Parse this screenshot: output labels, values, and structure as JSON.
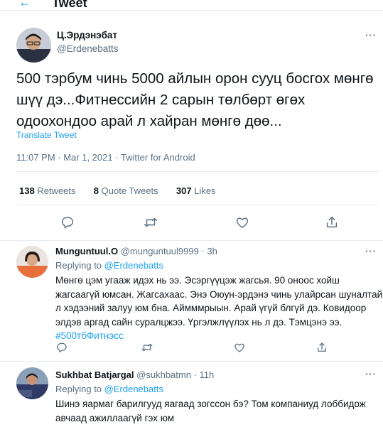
{
  "header": {
    "title": "Tweet"
  },
  "main_tweet": {
    "author_name": "Ц.Эрдэнэбат",
    "author_handle": "@Erdenebatts",
    "text": "500 тэрбум чинь 5000 айлын орон сууц босгох мөнгө шүү дэ...Фитнессийн 2 сарын төлбөрт өгөх одоохондоо арай л хайран мөнгө дөө...",
    "translate_label": "Translate Tweet",
    "timestamp": "11:07 PM · Mar 1, 2021 · Twitter for Android",
    "stats": {
      "retweets_count": "138",
      "retweets_label": "Retweets",
      "quotes_count": "8",
      "quotes_label": "Quote Tweets",
      "likes_count": "307",
      "likes_label": "Likes"
    }
  },
  "replies": [
    {
      "author_name": "Munguntuul.O",
      "author_handle": "@munguntuul9999",
      "time": "· 3h",
      "replying_prefix": "Replying to",
      "replying_to": "@Erdenebatts",
      "text_lines": [
        "Мөнгө цэм угааж идэх нь ээ. Эсэргүүцэж жагсья. 90 оноос хойш",
        "жагсаагүй юмсан. Жагсахаас. Энэ Оюун-эрдэнэ чинь улайрсан шуналтай",
        "л хэдээний залуу юм бна. Аймммрыын. Арай үгүй блгүй дэ. Ковидоор",
        "элдэв аргад сайн суралцжээ. Үргэлжлүүлэх нь л дэ. Тэмцэнэ ээ."
      ],
      "hashtag": "#500тбФитнэсс"
    },
    {
      "author_name": "Sukhbat Batjargal",
      "author_handle": "@sukhbatmn",
      "time": "· 11h",
      "replying_prefix": "Replying to",
      "replying_to": "@Erdenebatts",
      "text_lines": [
        "Шинэ яармаг барилгууд яагаад зогссон бэ? Том компаниуд лоббидож",
        "авчаад ажиллаагүй гэх юм"
      ]
    }
  ],
  "icons": {
    "back": "back-arrow-icon",
    "more": "more-icon",
    "reply": "reply-icon",
    "retweet": "retweet-icon",
    "like": "like-icon",
    "share": "share-icon"
  },
  "colors": {
    "accent": "#1da1f2",
    "muted": "#5b7083",
    "divider": "#e6ecf0",
    "text": "#0f1419"
  }
}
